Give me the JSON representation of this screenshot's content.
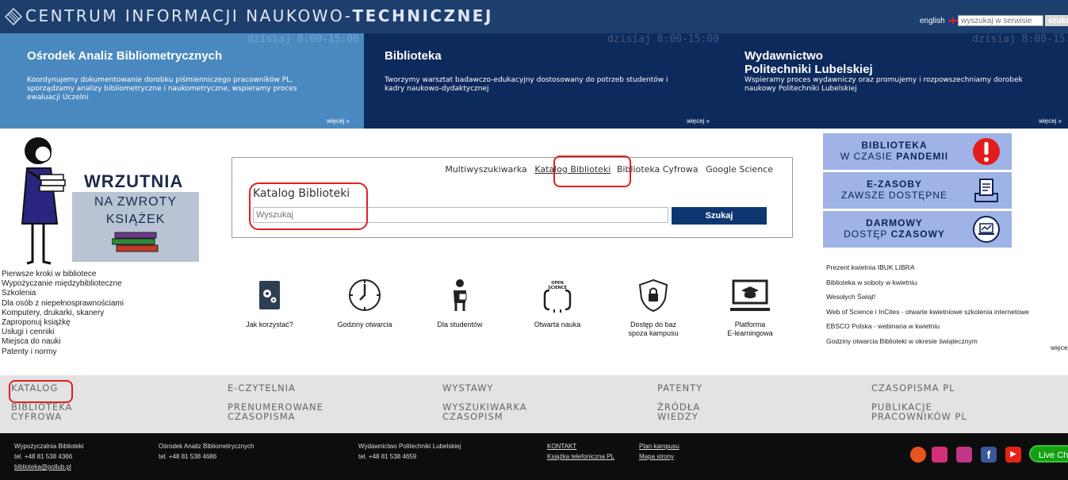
{
  "header": {
    "title_part1": "CENTRUM INFORMACJI NAUKOWO-",
    "title_part2": "TECHNICZNEJ",
    "lang_label": "english",
    "search_placeholder": "wyszukaj w serwisie",
    "search_button": "szukaj"
  },
  "banners": [
    {
      "hours": "dzisiaj 8:00-15:00",
      "title": "Ośrodek Analiz Bibliometrycznych",
      "desc": "Koordynujemy dokumentowanie dorobku piśmienniczego pracowników PL, sporządzamy analizy bibliometryczne i naukometryczne, wspieramy proces ewaluacji Uczelni",
      "more": "więcej »"
    },
    {
      "hours": "dzisiaj 8:00-15:00",
      "title": "Biblioteka",
      "desc": "Tworzymy warsztat badawczo-edukacyjny dostosowany do potrzeb studentów i kadry naukowo-dydaktycznej",
      "more": "więcej »"
    },
    {
      "hours": "dzisiaj 8:00-15:00",
      "title_line1": "Wydawnictwo",
      "title_line2": "Politechniki Lubelskiej",
      "desc": "Wspieramy proces wydawniczy oraz promujemy i rozpowszechniamy dorobek naukowy Politechniki Lubelskiej",
      "more": "więcej »"
    }
  ],
  "wrzutnia": {
    "title": "WRZUTNIA",
    "sub1": "NA ZWROTY",
    "sub2": "KSIĄŻEK"
  },
  "left_links": [
    "Pierwsze kroki w bibliotece",
    "Wypożyczanie międzybiblioteczne",
    "Szkolenia",
    "Dla osób z niepełnosprawnościami",
    "Komputery, drukarki, skanery",
    "Zaproponuj książkę",
    "Usługi i cenniki",
    "Miejsca do nauki",
    "Patenty i normy"
  ],
  "search": {
    "tabs": [
      "Multiwyszukiwarka",
      "Katalog Biblioteki",
      "Biblioteka Cyfrowa",
      "Google Science"
    ],
    "active_tab": "Katalog Biblioteki",
    "label": "Katalog Biblioteki",
    "placeholder": "Wyszukaj",
    "button": "Szukaj"
  },
  "icons": [
    {
      "label": "Jak korzystać?",
      "icon": "book-gear-icon"
    },
    {
      "label": "Godziny otwarcia",
      "icon": "clock-icon"
    },
    {
      "label": "Dla studentów",
      "icon": "student-icon"
    },
    {
      "label": "Otwarta nauka",
      "icon": "open-science-icon",
      "icon_text1": "OPEN",
      "icon_text2": "SCIENCE"
    },
    {
      "label_line1": "Dostęp do baz",
      "label_line2": "spoza kampusu",
      "icon": "shield-lock-icon"
    },
    {
      "label_line1": "Platforma",
      "label_line2": "E-learningowa",
      "icon": "elearning-icon"
    }
  ],
  "right_banners": [
    {
      "line1": "BIBLIOTEKA",
      "line2": "W CZASIE",
      "line2_bold": "PANDEMII",
      "icon": "exclamation-icon"
    },
    {
      "line1": "E-ZASOBY",
      "line2": "ZAWSZE DOSTĘPNE",
      "icon": "ebook-icon"
    },
    {
      "line1": "DARMOWY",
      "line2": "DOSTĘP",
      "line2_bold": "CZASOWY",
      "icon": "laptop-chart-icon"
    }
  ],
  "news": [
    "Prezent kwietnia IBUK LIBRA",
    "Biblioteka w soboty w kwietniu",
    "Wesołych Świąt!",
    "Web of Science i InCites - otwarte kwietniowe szkolenia internetowe",
    "EBSCO Polska - webinaria w kwietniu",
    "Godziny otwarcia Biblioteki w okresie świątecznym"
  ],
  "news_more": "więcej",
  "menu": [
    {
      "a": "KATALOG",
      "b1": "BIBLIOTEKA",
      "b2": "CYFROWA"
    },
    {
      "a": "E-CZYTELNIA",
      "b1": "PRENUMEROWANE",
      "b2": "CZASOPISMA"
    },
    {
      "a": "WYSTAWY",
      "b1": "WYSZUKIWARKA",
      "b2": "CZASOPISM"
    },
    {
      "a": "PATENTY",
      "b1": "ŹRÓDŁA",
      "b2": "WIEDZY"
    },
    {
      "a": "CZASOPISMA PL",
      "b1": "PUBLIKACJE",
      "b2": "PRACOWNIKÓW PL"
    }
  ],
  "footer": {
    "col1": [
      "Wypożyczalnia Biblioteki",
      "tel. +48 81 538 4366",
      "biblioteka@pollub.pl"
    ],
    "col2": [
      "Ośrodek Analiz Bibliometrycznych",
      "tel. +48 81 538 4686"
    ],
    "col3": [
      "Wydawnictwo Politechniki Lubelskiej",
      "tel. +48 81 538 4659"
    ],
    "col4": [
      "KONTAKT",
      "Książka telefoniczna PL"
    ],
    "col5": [
      "Plan kampusu",
      "Mapa strony"
    ],
    "live_chat": "Live Chat"
  },
  "colors": {
    "header": "#1d3f6e",
    "banner_light": "#4a89c0",
    "banner_dark": "#0d2a5c",
    "highlight": "#e02020",
    "button": "#0e3772",
    "right_banner": "#9fb3e6"
  }
}
